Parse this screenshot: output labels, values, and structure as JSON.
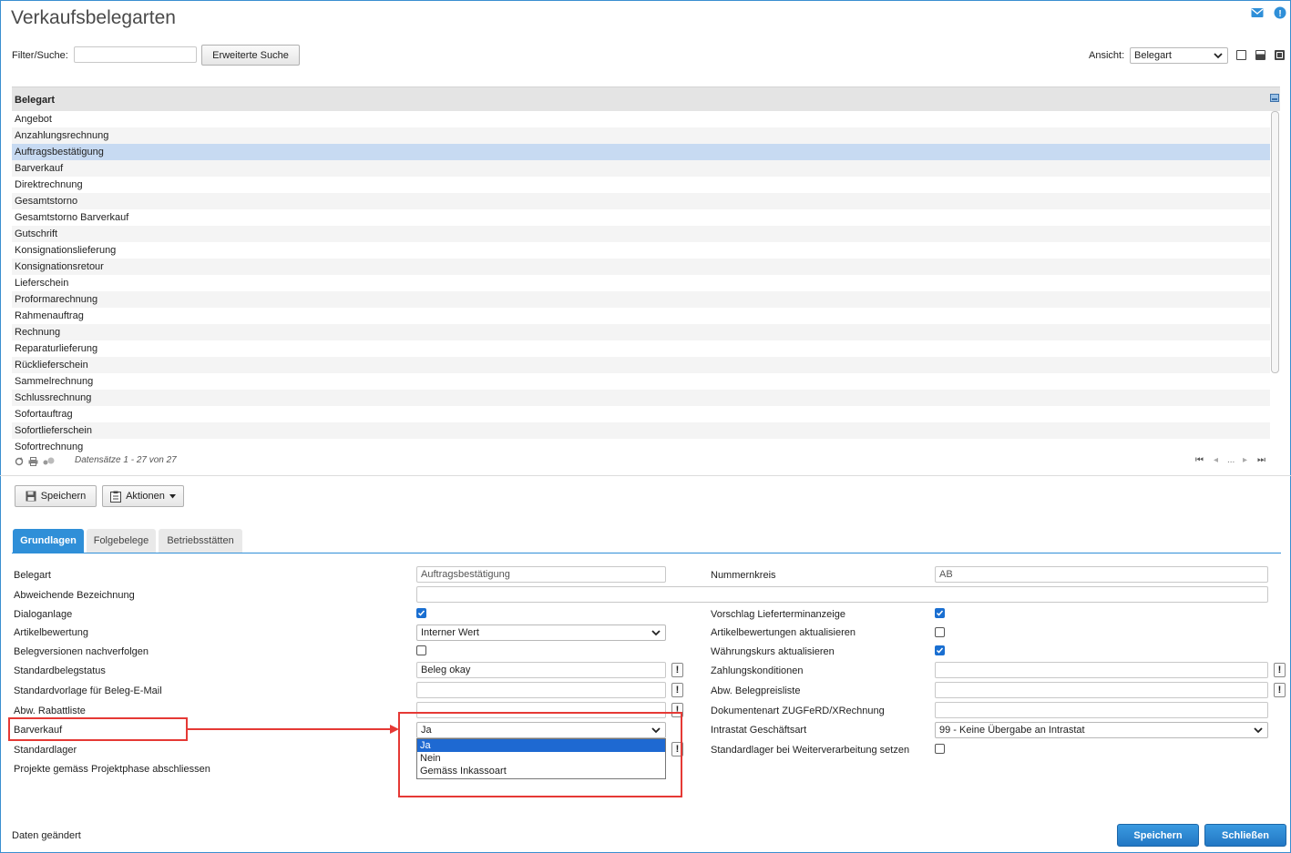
{
  "page": {
    "title": "Verkaufsbelegarten"
  },
  "filter": {
    "label": "Filter/Suche:",
    "value": "",
    "search_button": "Erweiterte Suche",
    "view_label": "Ansicht:",
    "view_value": "Belegart"
  },
  "grid": {
    "column": "Belegart",
    "rows": [
      "Angebot",
      "Anzahlungsrechnung",
      "Auftragsbestätigung",
      "Barverkauf",
      "Direktrechnung",
      "Gesamtstorno",
      "Gesamtstorno Barverkauf",
      "Gutschrift",
      "Konsignationslieferung",
      "Konsignationsretour",
      "Lieferschein",
      "Proformarechnung",
      "Rahmenauftrag",
      "Rechnung",
      "Reparaturlieferung",
      "Rücklieferschein",
      "Sammelrechnung",
      "Schlussrechnung",
      "Sofortauftrag",
      "Sofortlieferschein",
      "Sofortrechnung"
    ],
    "selected_index": 2,
    "records": "Datensätze 1 - 27 von 27",
    "pager_ellipsis": "..."
  },
  "toolbar": {
    "save": "Speichern",
    "actions": "Aktionen"
  },
  "tabs": [
    "Grundlagen",
    "Folgebelege",
    "Betriebsstätten"
  ],
  "form": {
    "left": {
      "belegart": {
        "label": "Belegart",
        "value": "Auftragsbestätigung"
      },
      "abw_bezeichnung": {
        "label": "Abweichende Bezeichnung",
        "value": ""
      },
      "dialoganlage": {
        "label": "Dialoganlage",
        "checked": true
      },
      "artikelbewertung": {
        "label": "Artikelbewertung",
        "value": "Interner Wert"
      },
      "belegversionen": {
        "label": "Belegversionen nachverfolgen",
        "checked": false
      },
      "standardbelegstatus": {
        "label": "Standardbelegstatus",
        "value": "Beleg okay"
      },
      "standardvorlage": {
        "label": "Standardvorlage für Beleg-E-Mail",
        "value": ""
      },
      "abw_rabattliste": {
        "label": "Abw. Rabattliste",
        "value": ""
      },
      "barverkauf": {
        "label": "Barverkauf",
        "value": "Ja",
        "options": [
          "Ja",
          "Nein",
          "Gemäss Inkassoart"
        ]
      },
      "standardlager": {
        "label": "Standardlager"
      },
      "projekte": {
        "label": "Projekte gemäss Projektphase abschliessen"
      }
    },
    "right": {
      "nummernkreis": {
        "label": "Nummernkreis",
        "value": "AB"
      },
      "vorschlag": {
        "label": "Vorschlag Lieferterminanzeige",
        "checked": true
      },
      "artikelbew_akt": {
        "label": "Artikelbewertungen aktualisieren",
        "checked": false
      },
      "waehrungskurs": {
        "label": "Währungskurs aktualisieren",
        "checked": true
      },
      "zahlungskonditionen": {
        "label": "Zahlungskonditionen",
        "value": ""
      },
      "abw_belegpreisliste": {
        "label": "Abw. Belegpreisliste",
        "value": ""
      },
      "dokumentenart": {
        "label": "Dokumentenart ZUGFeRD/XRechnung",
        "value": ""
      },
      "intrastat": {
        "label": "Intrastat Geschäftsart",
        "value": "99 - Keine Übergabe an Intrastat"
      },
      "standardlager_weiter": {
        "label": "Standardlager bei Weiterverarbeitung setzen",
        "checked": false
      }
    },
    "exclaim": "!"
  },
  "footer": {
    "status": "Daten geändert",
    "save": "Speichern",
    "close": "Schließen"
  },
  "colors": {
    "accent": "#2f8fd8",
    "selection": "#c7daf2",
    "highlight": "#e53935"
  }
}
